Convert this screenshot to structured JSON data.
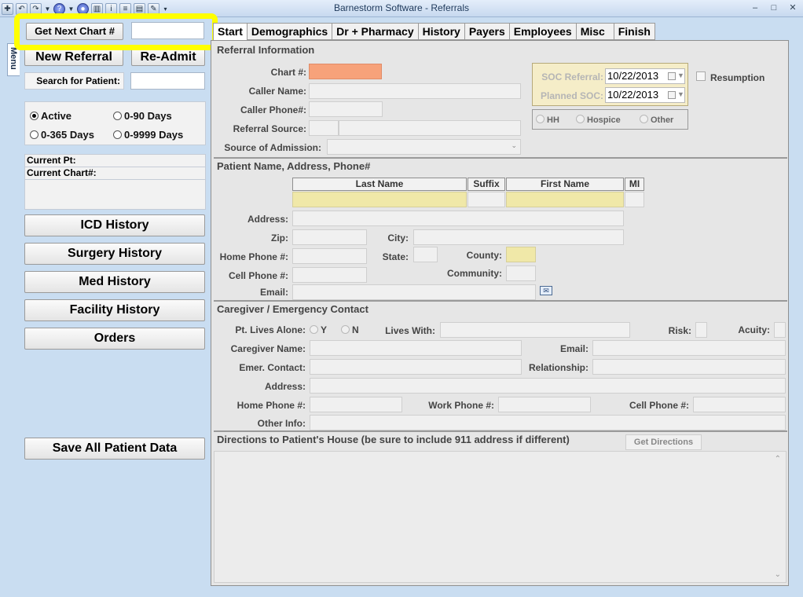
{
  "window": {
    "title": "Barnestorm Software - Referrals",
    "controls": {
      "minimize": "–",
      "restore": "□",
      "close": "✕"
    }
  },
  "quick_access": {
    "icons": [
      "app-icon",
      "undo-icon",
      "redo-icon",
      "help-icon",
      "globe-icon",
      "chart-icon",
      "info-icon",
      "list-icon",
      "document-icon",
      "pin-icon"
    ]
  },
  "side_tab": {
    "label": "Menu"
  },
  "left_panel": {
    "get_next_chart_label": "Get Next Chart #",
    "chart_input_value": "",
    "new_referral_label": "New Referral",
    "readmit_label": "Re-Admit",
    "search_label": "Search for Patient:",
    "search_value": "",
    "filters": [
      {
        "label": "Active",
        "selected": true
      },
      {
        "label": "0-90 Days",
        "selected": false
      },
      {
        "label": "0-365 Days",
        "selected": false
      },
      {
        "label": "0-9999 Days",
        "selected": false
      }
    ],
    "current_pt_label": "Current Pt:",
    "current_chart_label": "Current Chart#:",
    "history_buttons": [
      "ICD History",
      "Surgery History",
      "Med History",
      "Facility History",
      "Orders"
    ],
    "save_label": "Save All Patient Data"
  },
  "tabs": [
    "Start",
    "Demographics",
    "Dr + Pharmacy",
    "History",
    "Payers",
    "Employees",
    "Misc",
    "Finish"
  ],
  "active_tab": "Start",
  "referral": {
    "title": "Referral Information",
    "chart_label": "Chart #:",
    "caller_name_label": "Caller Name:",
    "caller_phone_label": "Caller Phone#:",
    "referral_source_label": "Referral Source:",
    "source_admission_label": "Source of Admission:",
    "soc_referral_label": "SOC Referral:",
    "soc_referral_value": "10/22/2013",
    "planned_soc_label": "Planned SOC:",
    "planned_soc_value": "10/22/2013",
    "resumption_label": "Resumption",
    "type_options": [
      "HH",
      "Hospice",
      "Other"
    ]
  },
  "patient": {
    "title": "Patient Name, Address, Phone#",
    "last_name_header": "Last Name",
    "suffix_header": "Suffix",
    "first_name_header": "First Name",
    "mi_header": "MI",
    "address_label": "Address:",
    "zip_label": "Zip:",
    "city_label": "City:",
    "home_phone_label": "Home Phone #:",
    "state_label": "State:",
    "county_label": "County:",
    "cell_phone_label": "Cell Phone #:",
    "community_label": "Community:",
    "email_label": "Email:"
  },
  "caregiver": {
    "title": "Caregiver / Emergency Contact",
    "lives_alone_label": "Pt. Lives Alone:",
    "yes_label": "Y",
    "no_label": "N",
    "lives_with_label": "Lives With:",
    "risk_label": "Risk:",
    "acuity_label": "Acuity:",
    "caregiver_name_label": "Caregiver Name:",
    "email_label": "Email:",
    "emer_contact_label": "Emer. Contact:",
    "relationship_label": "Relationship:",
    "address_label": "Address:",
    "home_phone_label": "Home Phone #:",
    "work_phone_label": "Work Phone #:",
    "cell_phone_label": "Cell Phone #:",
    "other_info_label": "Other Info:"
  },
  "directions": {
    "title": "Directions to Patient's House (be sure to include 911 address if different)",
    "get_directions_label": "Get Directions"
  },
  "colors": {
    "highlight": "#ffff00",
    "chart_field": "#f7a27a",
    "name_field": "#f0e8a8",
    "background": "#c9ddf1"
  }
}
